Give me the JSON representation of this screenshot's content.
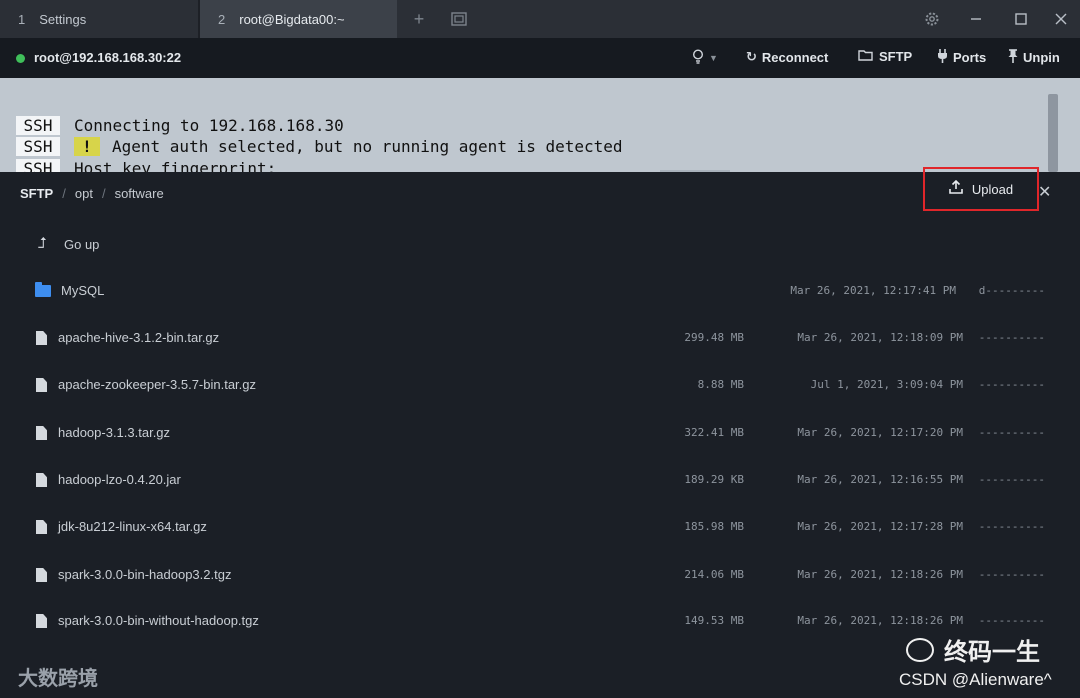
{
  "tabs": [
    {
      "num": "1",
      "label": "Settings"
    },
    {
      "num": "2",
      "label": "root@Bigdata00:~"
    }
  ],
  "tab_actions": {
    "new_tab_icon": "plus-icon",
    "split_icon": "window-icon"
  },
  "window_controls": {
    "settings_icon": "gear-icon",
    "minimize_icon": "minimize-icon",
    "maximize_icon": "maximize-icon",
    "close_icon": "close-icon"
  },
  "session": {
    "status_color": "#3fbf5a",
    "host": "root@192.168.168.30:22",
    "buttons": {
      "reconnect": "Reconnect",
      "sftp": "SFTP",
      "ports": "Ports",
      "unpin": "Unpin"
    }
  },
  "terminal": {
    "lines": [
      {
        "tag": "SSH",
        "text": "Connecting to 192.168.168.30"
      },
      {
        "tag": "SSH",
        "badge": "!",
        "text": "Agent auth selected, but no running agent is detected"
      },
      {
        "tag": "SSH",
        "text": "Host key fingerprint:"
      }
    ]
  },
  "sftp": {
    "breadcrumb": [
      "SFTP",
      "opt",
      "software"
    ],
    "upload_label": "Upload",
    "go_up_label": "Go up",
    "entries": [
      {
        "type": "folder",
        "name": "MySQL",
        "size": "",
        "date": "Mar 26, 2021, 12:17:41 PM",
        "perm": "d---------"
      },
      {
        "type": "file",
        "name": "apache-hive-3.1.2-bin.tar.gz",
        "size": "299.48 MB",
        "date": "Mar 26, 2021, 12:18:09 PM",
        "perm": "----------"
      },
      {
        "type": "file",
        "name": "apache-zookeeper-3.5.7-bin.tar.gz",
        "size": "8.88 MB",
        "date": "Jul 1, 2021, 3:09:04 PM",
        "perm": "----------"
      },
      {
        "type": "file",
        "name": "hadoop-3.1.3.tar.gz",
        "size": "322.41 MB",
        "date": "Mar 26, 2021, 12:17:20 PM",
        "perm": "----------"
      },
      {
        "type": "file",
        "name": "hadoop-lzo-0.4.20.jar",
        "size": "189.29 KB",
        "date": "Mar 26, 2021, 12:16:55 PM",
        "perm": "----------"
      },
      {
        "type": "file",
        "name": "jdk-8u212-linux-x64.tar.gz",
        "size": "185.98 MB",
        "date": "Mar 26, 2021, 12:17:28 PM",
        "perm": "----------"
      },
      {
        "type": "file",
        "name": "spark-3.0.0-bin-hadoop3.2.tgz",
        "size": "214.06 MB",
        "date": "Mar 26, 2021, 12:18:26 PM",
        "perm": "----------"
      },
      {
        "type": "file",
        "name": "spark-3.0.0-bin-without-hadoop.tgz",
        "size": "149.53 MB",
        "date": "Mar 26, 2021, 12:18:26 PM",
        "perm": "----------"
      }
    ]
  },
  "watermarks": {
    "left": "大数跨境",
    "right": "终码一生",
    "csdn": "CSDN @Alienware^"
  }
}
